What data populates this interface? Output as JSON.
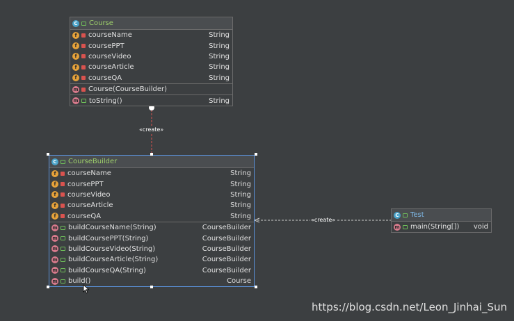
{
  "course": {
    "title": "Course",
    "fields": [
      {
        "name": "courseName",
        "type": "String"
      },
      {
        "name": "coursePPT",
        "type": "String"
      },
      {
        "name": "courseVideo",
        "type": "String"
      },
      {
        "name": "courseArticle",
        "type": "String"
      },
      {
        "name": "courseQA",
        "type": "String"
      }
    ],
    "constructors": [
      {
        "name": "Course(CourseBuilder)",
        "type": ""
      }
    ],
    "methods": [
      {
        "name": "toString()",
        "type": "String"
      }
    ]
  },
  "builder": {
    "title": "CourseBuilder",
    "fields": [
      {
        "name": "courseName",
        "type": "String"
      },
      {
        "name": "coursePPT",
        "type": "String"
      },
      {
        "name": "courseVideo",
        "type": "String"
      },
      {
        "name": "courseArticle",
        "type": "String"
      },
      {
        "name": "courseQA",
        "type": "String"
      }
    ],
    "methods": [
      {
        "name": "buildCourseName(String)",
        "type": "CourseBuilder"
      },
      {
        "name": "buildCoursePPT(String)",
        "type": "CourseBuilder"
      },
      {
        "name": "buildCourseVideo(String)",
        "type": "CourseBuilder"
      },
      {
        "name": "buildCourseArticle(String)",
        "type": "CourseBuilder"
      },
      {
        "name": "buildCourseQA(String)",
        "type": "CourseBuilder"
      },
      {
        "name": "build()",
        "type": "Course"
      }
    ]
  },
  "test": {
    "title": "Test",
    "methods": [
      {
        "name": "main(String[])",
        "type": "void"
      }
    ]
  },
  "relations": {
    "builder_to_course": "«create»",
    "test_to_builder": "«create»"
  },
  "badges": {
    "field": "f",
    "method": "m",
    "class": "C"
  },
  "colors": {
    "background": "#3c3f41",
    "class_title": "#9fd16b",
    "selection": "#5a8fd6",
    "relation_line": "#d9534f"
  },
  "watermark": "https://blog.csdn.net/Leon_Jinhai_Sun"
}
